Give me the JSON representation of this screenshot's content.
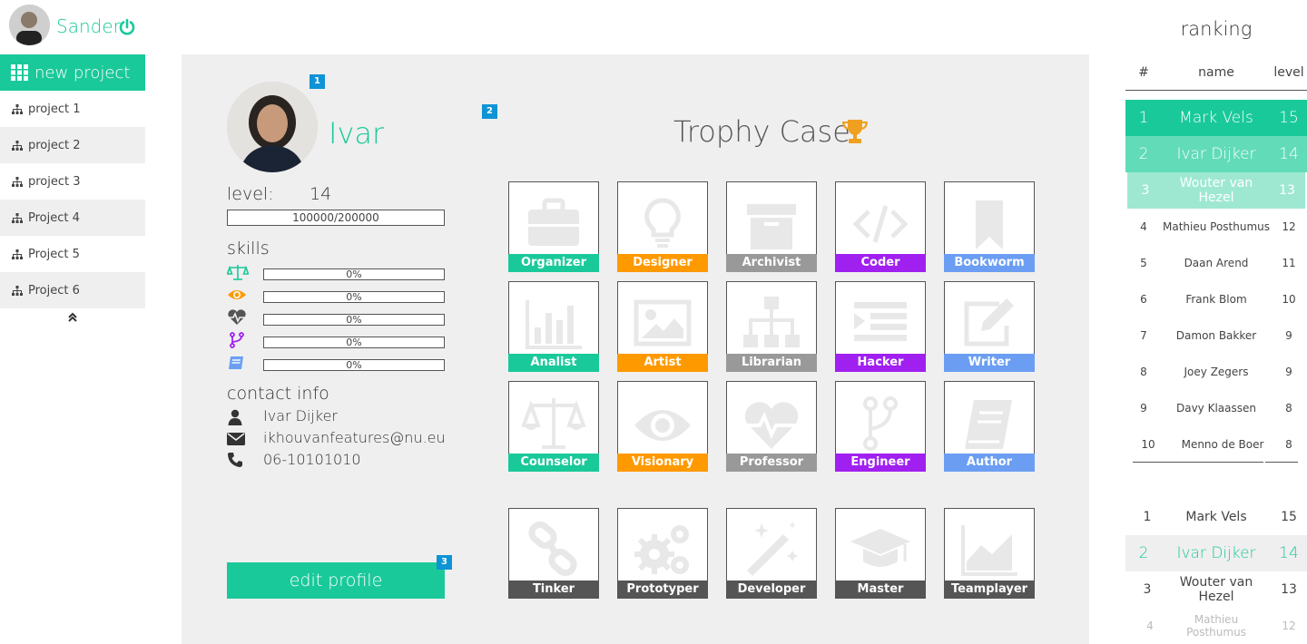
{
  "colors": {
    "accent": "#1ac99a",
    "badge": "#0e93d6",
    "orange": "#ff9900",
    "purple": "#a020f0",
    "gray": "#999999",
    "blue": "#6b9ef2",
    "dark": "#555555"
  },
  "user": {
    "name": "Sander"
  },
  "sidebar": {
    "new_project_label": "new project",
    "projects": [
      "project 1",
      "project 2",
      "project 3",
      "Project 4",
      "Project 5",
      "Project 6"
    ]
  },
  "profile": {
    "badge_photo": "1",
    "badge_trophies": "2",
    "badge_edit": "3",
    "name": "Ivar",
    "level_label": "level:",
    "level_value": "14",
    "xp": "100000/200000",
    "skills_label": "skills",
    "skills": [
      {
        "icon": "balance-scale-icon",
        "value": "0%"
      },
      {
        "icon": "eye-icon",
        "value": "0%"
      },
      {
        "icon": "heartbeat-icon",
        "value": "0%"
      },
      {
        "icon": "code-fork-icon",
        "value": "0%"
      },
      {
        "icon": "book-icon",
        "value": "0%"
      }
    ],
    "contact_label": "contact info",
    "contact": {
      "name": "Ivar Dijker",
      "email": "ikhouvanfeatures@nu.eu",
      "phone": "06-10101010"
    },
    "edit_label": "edit profile"
  },
  "trophies": {
    "title": "Trophy Case",
    "rows": [
      [
        "Organizer",
        "Designer",
        "Archivist",
        "Coder",
        "Bookworm"
      ],
      [
        "Analist",
        "Artist",
        "Librarian",
        "Hacker",
        "Writer"
      ],
      [
        "Counselor",
        "Visionary",
        "Professor",
        "Engineer",
        "Author"
      ],
      [
        "Tinker",
        "Prototyper",
        "Developer",
        "Master",
        "Teamplayer"
      ]
    ]
  },
  "ranking": {
    "title": "ranking",
    "headers": {
      "rank": "#",
      "name": "name",
      "level": "level"
    },
    "top": [
      {
        "rank": "1",
        "name": "Mark Vels",
        "level": "15"
      },
      {
        "rank": "2",
        "name": "Ivar Dijker",
        "level": "14"
      },
      {
        "rank": "3",
        "name": "Wouter van Hezel",
        "level": "13"
      },
      {
        "rank": "4",
        "name": "Mathieu Posthumus",
        "level": "12"
      },
      {
        "rank": "5",
        "name": "Daan Arend",
        "level": "11"
      },
      {
        "rank": "6",
        "name": "Frank Blom",
        "level": "10"
      },
      {
        "rank": "7",
        "name": "Damon Bakker",
        "level": "9"
      },
      {
        "rank": "8",
        "name": "Joey Zegers",
        "level": "9"
      },
      {
        "rank": "9",
        "name": "Davy Klaassen",
        "level": "8"
      },
      {
        "rank": "10",
        "name": "Menno de Boer",
        "level": "8"
      }
    ],
    "nearby": [
      {
        "rank": "1",
        "name": "Mark Vels",
        "level": "15"
      },
      {
        "rank": "2",
        "name": "Ivar Dijker",
        "level": "14"
      },
      {
        "rank": "3",
        "name": "Wouter van Hezel",
        "level": "13"
      },
      {
        "rank": "4",
        "name": "Mathieu Posthumus",
        "level": "12"
      }
    ]
  }
}
